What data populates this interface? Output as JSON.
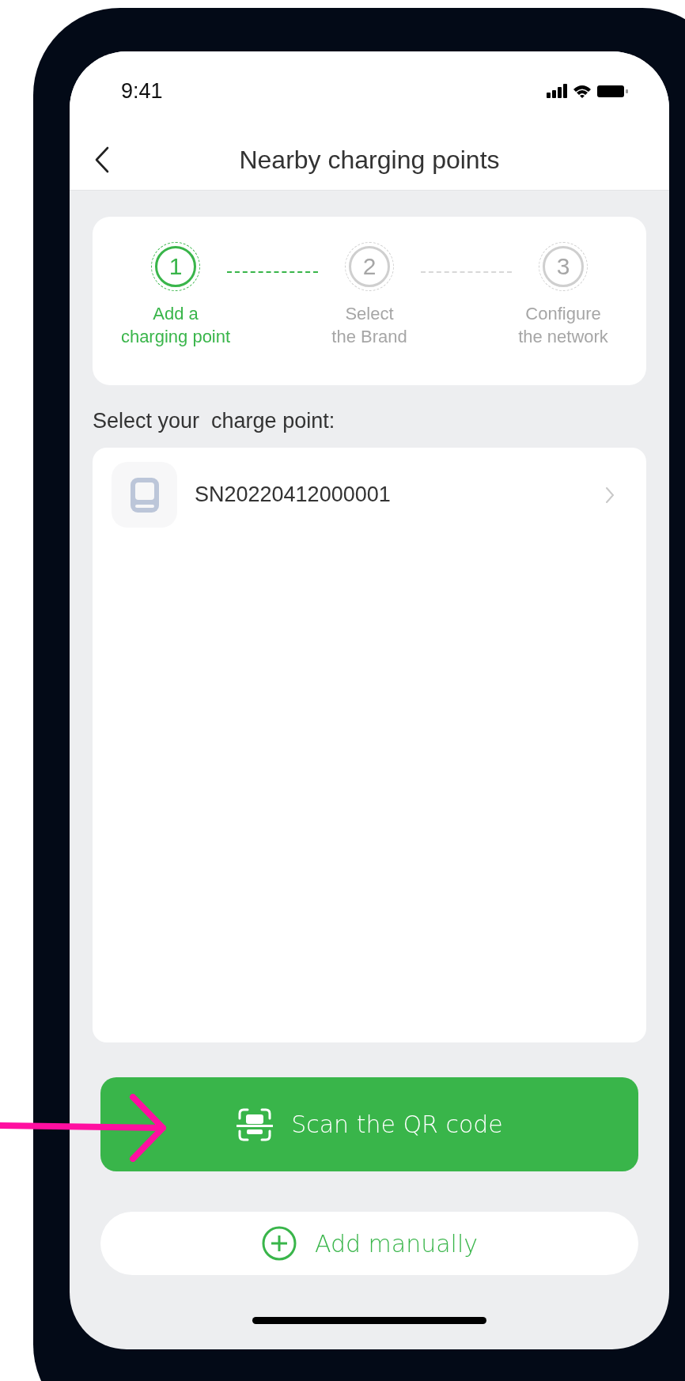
{
  "status_bar": {
    "time": "9:41"
  },
  "header": {
    "title": "Nearby charging points"
  },
  "steps": [
    {
      "number": "1",
      "label": "Add a\ncharging point",
      "selected": true
    },
    {
      "number": "2",
      "label": "Select\nthe Brand",
      "selected": false
    },
    {
      "number": "3",
      "label": "Configure\nthe network",
      "selected": false
    }
  ],
  "section_label": "Select your  charge point:",
  "charge_points": [
    {
      "serial": "SN20220412000001"
    }
  ],
  "buttons": [
    {
      "kind": "primary",
      "label": "Scan the QR code"
    },
    {
      "kind": "secondary",
      "label": "Add manually"
    }
  ]
}
